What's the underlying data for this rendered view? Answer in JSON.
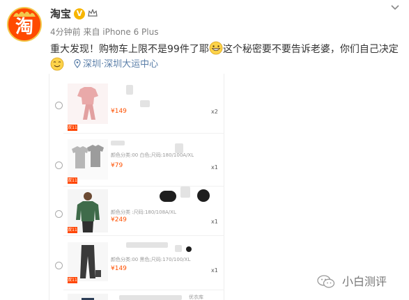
{
  "account": {
    "name": "淘宝",
    "verified_badge": "V",
    "avatar_char": "淘",
    "time": "4分钟前",
    "source": "来自 iPhone 6 Plus"
  },
  "post": {
    "text_part1": "重大发现！购物车上限不是99件了耶",
    "text_part2": "这个秘密要不要告诉老婆，你们自己决定",
    "location": "深圳·深圳大运中心"
  },
  "cart": {
    "items": [
      {
        "price": "¥149",
        "qty": "x2",
        "spec": "",
        "tag": "双11"
      },
      {
        "price": "¥79",
        "qty": "x1",
        "spec": "颜色分类:00 白色;尺码:180/100A/XL",
        "tag": "双11"
      },
      {
        "price": "¥249",
        "qty": "x1",
        "spec": "颜色分类 :尺码:180/108A/XL",
        "tag": "双11"
      },
      {
        "price": "¥149",
        "qty": "x1",
        "spec": "颜色分类:00 黑色;尺码:170/100/XL",
        "tag": "双11"
      }
    ],
    "last_label": "优衣库"
  },
  "watermark": {
    "text": "小白测评"
  },
  "colors": {
    "brand_orange": "#ff4a00",
    "link_blue": "#5a7ea8",
    "price_orange": "#ff5000",
    "verified_gold": "#f7b500"
  },
  "icons": [
    "avatar-logo",
    "verified-icon",
    "member-crown-icon",
    "chevron-down-icon",
    "grin-emoji",
    "smile-emoji",
    "location-pin-icon",
    "wechat-icon"
  ]
}
